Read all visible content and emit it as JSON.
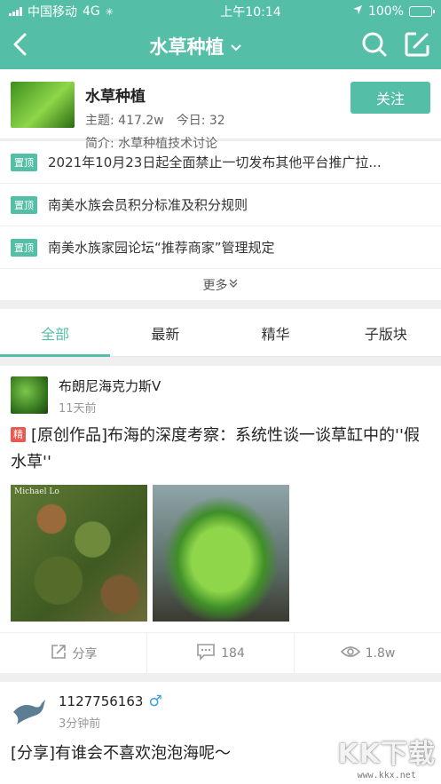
{
  "status_bar": {
    "carrier": "中国移动",
    "network": "4G",
    "time": "上午10:14",
    "battery": "100%",
    "battery_level": 1.0
  },
  "nav": {
    "title": "水草种植",
    "back_icon": "back-arrow-icon",
    "search_icon": "search-icon",
    "compose_icon": "compose-icon"
  },
  "forum": {
    "name": "水草种植",
    "topics_label": "主题: 417.2w",
    "today_label": "今日: 32",
    "desc": "简介: 水草种植技术讨论",
    "follow_label": "关注"
  },
  "pinned": {
    "tag": "置顶",
    "items": [
      "2021年10月23日起全面禁止一切发布其他平台推广拉...",
      "南美水族会员积分标准及积分规则",
      "南美水族家园论坛“推荐商家”管理规定"
    ],
    "more_label": "更多"
  },
  "tabs": [
    "全部",
    "最新",
    "精华",
    "子版块"
  ],
  "posts": [
    {
      "author": "布朗尼海克力斯Ⅴ",
      "time": "11天前",
      "badge": "精",
      "title": "[原创作品]布海的深度考察：系统性谈一谈草缸中的''假水草''",
      "image_watermark": "Michael Lo",
      "share_label": "分享",
      "comments": "184",
      "views": "1.8w"
    },
    {
      "author": "1127756163",
      "time": "3分钟前",
      "title": "[分享]有谁会不喜欢泡泡海呢～"
    }
  ],
  "watermark": {
    "logo": "KK下载",
    "url": "www.kkx.net"
  },
  "colors": {
    "accent": "#54bfa6",
    "essence": "#e8594f",
    "male": "#3a9ee0"
  }
}
